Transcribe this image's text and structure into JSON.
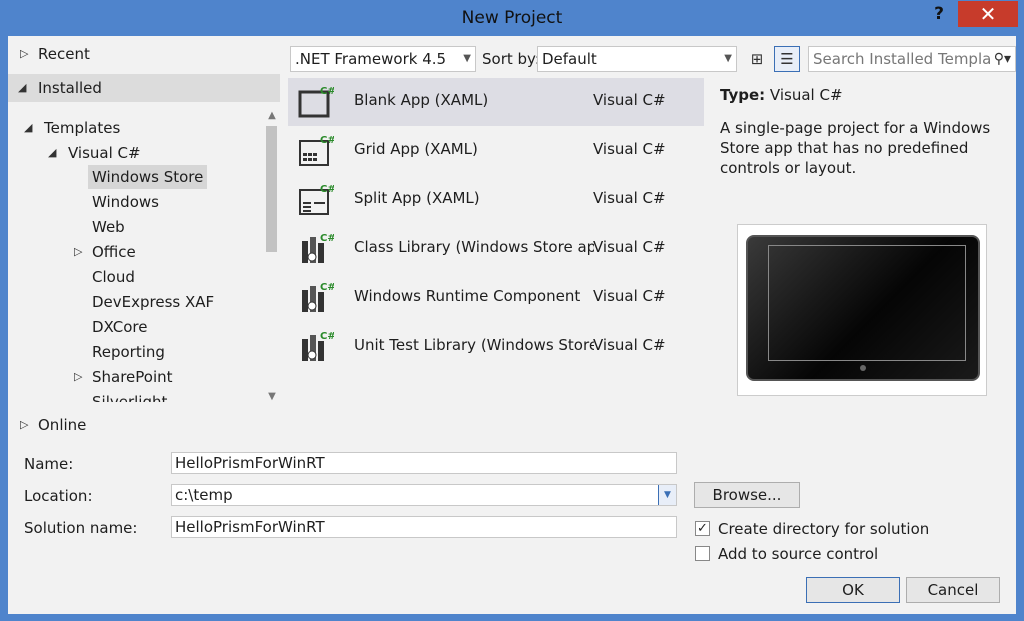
{
  "window": {
    "title": "New Project",
    "help": "?",
    "close": "✕"
  },
  "tree": {
    "recent": "Recent",
    "installed": "Installed",
    "templates": "Templates",
    "visual_csharp": "Visual C#",
    "items": [
      "Windows Store",
      "Windows",
      "Web",
      "Office",
      "Cloud",
      "DevExpress XAF",
      "DXCore",
      "Reporting",
      "SharePoint",
      "Silverlight"
    ],
    "online": "Online"
  },
  "toolbar": {
    "framework": ".NET Framework 4.5",
    "sort_label": "Sort by:",
    "sort_value": "Default",
    "search_placeholder": "Search Installed Templa"
  },
  "templates": [
    {
      "name": "Blank App (XAML)",
      "lang": "Visual C#"
    },
    {
      "name": "Grid App (XAML)",
      "lang": "Visual C#"
    },
    {
      "name": "Split App (XAML)",
      "lang": "Visual C#"
    },
    {
      "name": "Class Library (Windows Store apps)",
      "lang": "Visual C#"
    },
    {
      "name": "Windows Runtime Component",
      "lang": "Visual C#"
    },
    {
      "name": "Unit Test Library (Windows Store a...",
      "lang": "Visual C#"
    }
  ],
  "details": {
    "type_label": "Type:",
    "type_value": "Visual C#",
    "description": "A single-page project for a Windows Store app that has no predefined controls or layout."
  },
  "form": {
    "name_label": "Name:",
    "name_value": "HelloPrismForWinRT",
    "location_label": "Location:",
    "location_value": "c:\\temp",
    "solution_label": "Solution name:",
    "solution_value": "HelloPrismForWinRT",
    "browse": "Browse...",
    "create_dir": "Create directory for solution",
    "create_dir_checked": true,
    "add_source": "Add to source control",
    "add_source_checked": false,
    "ok": "OK",
    "cancel": "Cancel"
  },
  "colors": {
    "title_bar": "#4f84cc",
    "close": "#c73b2b",
    "selection": "#dddde4",
    "accent": "#3b6fb5"
  }
}
